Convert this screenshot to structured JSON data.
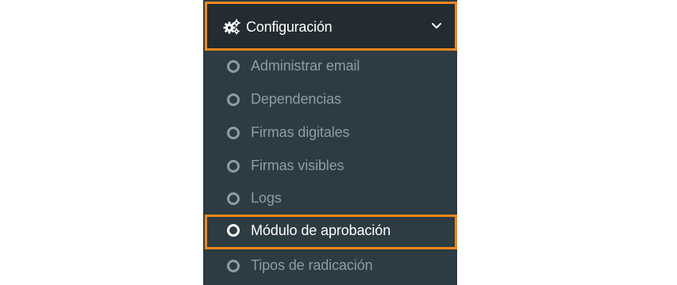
{
  "sidebar": {
    "section": {
      "icon": "cogs-icon",
      "label": "Configuración",
      "toggle_icon": "chevron-down-icon"
    },
    "items": [
      {
        "label": "Administrar email",
        "icon": "circle-outline-icon"
      },
      {
        "label": "Dependencias",
        "icon": "circle-outline-icon"
      },
      {
        "label": "Firmas digitales",
        "icon": "circle-outline-icon"
      },
      {
        "label": "Firmas visibles",
        "icon": "circle-outline-icon"
      },
      {
        "label": "Logs",
        "icon": "circle-outline-icon"
      },
      {
        "label": "Módulo de aprobación",
        "icon": "circle-outline-icon",
        "active": true
      },
      {
        "label": "Tipos de radicación",
        "icon": "circle-outline-icon"
      }
    ]
  },
  "colors": {
    "sidebar_bg": "#2d3b42",
    "header_bg": "#222c31",
    "highlight_border": "#f0881c",
    "inactive_text": "#8d9da4",
    "active_text": "#ffffff"
  }
}
